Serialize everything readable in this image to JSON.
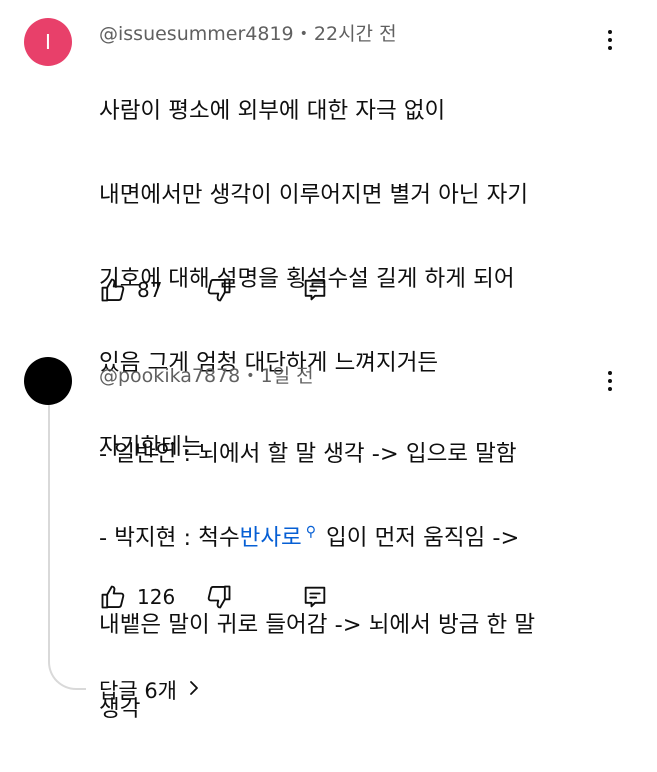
{
  "comments": [
    {
      "avatar_letter": "I",
      "avatar_color": "#e8406a",
      "author": "@issuesummer4819",
      "time": "22시간 전",
      "lines": [
        "사람이 평소에 외부에 대한 자극 없이",
        "내면에서만 생각이 이루어지면 별거 아닌 자기",
        "기호에 대해 설명을 횡설수설 길게 하게 되어",
        "있음 그게 엄청 대단하게 느껴지거든",
        "자기한테는"
      ],
      "likes": "87"
    },
    {
      "avatar_color": "#000000",
      "author": "@pookika7878",
      "time": "1일 전",
      "line1": "- 일반인 : 뇌에서 할 말 생각 -> 입으로 말함",
      "line2_prefix": "- 박지현 : 척수",
      "line2_link": "반사로",
      "line2_suffix": "입이 먼저 움직임 ->",
      "line3": "내뱉은 말이 귀로 들어감 -> 뇌에서 방금 한 말",
      "line4": "생각",
      "likes": "126",
      "replies_label": "답글 6개"
    }
  ],
  "colors": {
    "link": "#065fd4",
    "meta": "#606060",
    "text": "#0f0f0f"
  }
}
